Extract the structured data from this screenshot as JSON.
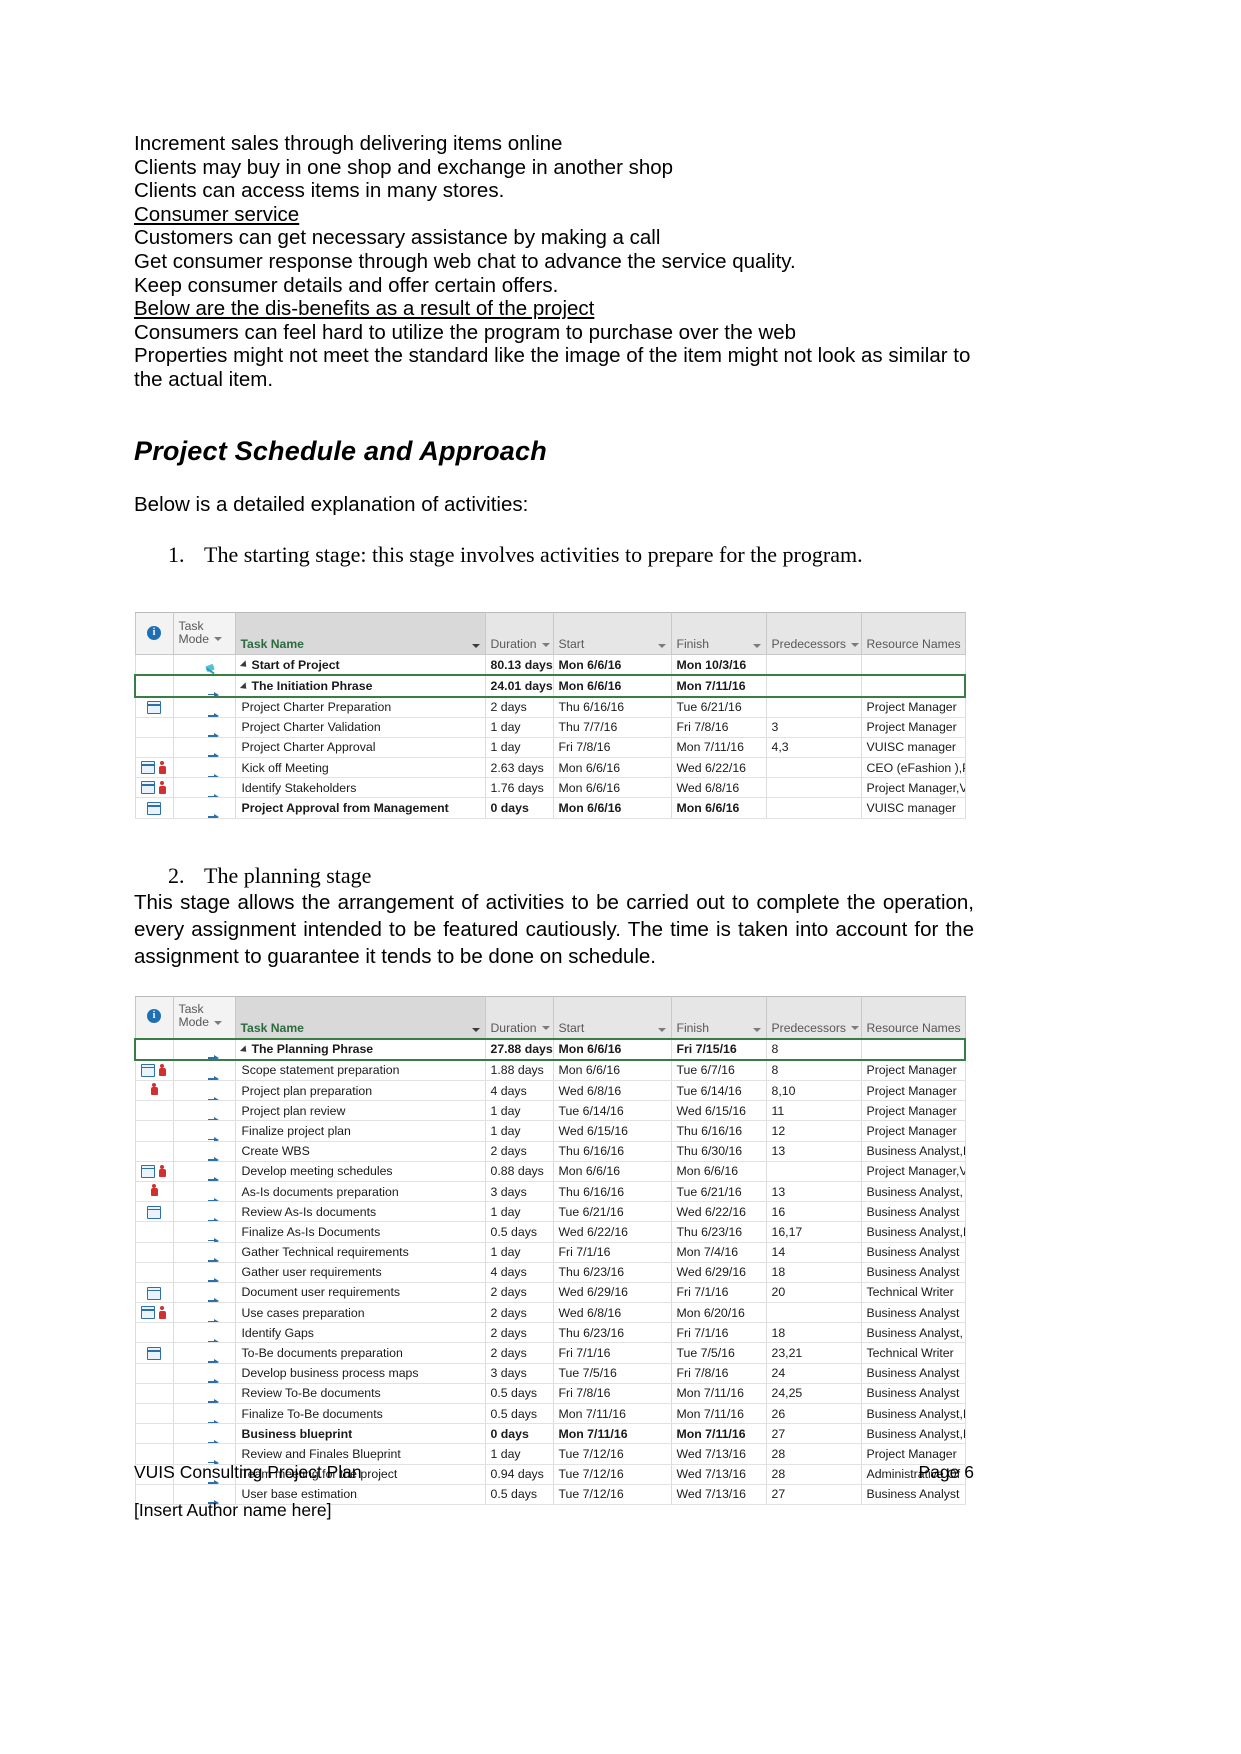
{
  "document": {
    "intro_lines": [
      {
        "text": "Increment sales through delivering items online",
        "underline": false
      },
      {
        "text": "Clients may buy in one shop and exchange in another shop",
        "underline": false
      },
      {
        "text": "Clients can access items in many stores.",
        "underline": false
      },
      {
        "text": "Consumer service",
        "underline": true
      },
      {
        "text": "Customers can get necessary assistance by making a call",
        "underline": false
      },
      {
        "text": "Get consumer response through web chat to advance the service quality.",
        "underline": false
      },
      {
        "text": "Keep consumer details and offer certain offers.",
        "underline": false
      },
      {
        "text": "Below are the dis-benefits as a result of the project",
        "underline": true
      },
      {
        "text": "Consumers can feel hard to utilize the program to purchase over the web",
        "underline": false
      }
    ],
    "wrap_paragraph": "Properties might not meet the standard like the image of the item might not look as similar to the actual item.",
    "heading": "Project Schedule and Approach",
    "lead_in": "Below is a detailed explanation of activities:",
    "list_1_number": "1.",
    "list_1_text": "The starting stage: this stage involves activities to prepare for the program.",
    "list_2_number": "2.",
    "list_2_text": "The planning stage",
    "planning_paragraph": "This stage allows the arrangement of activities to be carried out to complete the operation, every assignment intended to be featured cautiously. The time is taken into account for the assignment to guarantee it tends to be done on schedule."
  },
  "footer": {
    "left": "VUIS Consulting Project Plan",
    "right": "Page 6",
    "author": "[Insert Author name here]"
  },
  "table_columns": {
    "info": "",
    "task_mode_line1": "Task",
    "task_mode_line2": "Mode",
    "task_name": "Task Name",
    "duration": "Duration",
    "start": "Start",
    "finish": "Finish",
    "predecessors": "Predecessors",
    "resource_names": "Resource Names"
  },
  "table_initiation": {
    "rows": [
      {
        "info": "",
        "mode": "pin",
        "name": "Start of Project",
        "level": 0,
        "bold": true,
        "expander": true,
        "duration": "80.13 days",
        "start": "Mon 6/6/16",
        "finish": "Mon 10/3/16",
        "pred": "",
        "res": "",
        "selected": false
      },
      {
        "info": "",
        "mode": "auto",
        "name": "The Initiation Phrase",
        "level": 1,
        "bold": true,
        "expander": true,
        "duration": "24.01 days",
        "start": "Mon 6/6/16",
        "finish": "Mon 7/11/16",
        "pred": "",
        "res": "",
        "selected": true
      },
      {
        "info": "cal",
        "mode": "auto",
        "name": "Project Charter Preparation",
        "level": 2,
        "bold": false,
        "expander": false,
        "duration": "2 days",
        "start": "Thu 6/16/16",
        "finish": "Tue 6/21/16",
        "pred": "",
        "res": "Project Manager",
        "selected": false
      },
      {
        "info": "",
        "mode": "auto",
        "name": "Project Charter Validation",
        "level": 2,
        "bold": false,
        "expander": false,
        "duration": "1 day",
        "start": "Thu 7/7/16",
        "finish": "Fri 7/8/16",
        "pred": "3",
        "res": "Project Manager",
        "selected": false
      },
      {
        "info": "",
        "mode": "auto",
        "name": "Project Charter Approval",
        "level": 2,
        "bold": false,
        "expander": false,
        "duration": "1 day",
        "start": "Fri 7/8/16",
        "finish": "Mon 7/11/16",
        "pred": "4,3",
        "res": "VUISC manager",
        "selected": false
      },
      {
        "info": "cal-person",
        "mode": "auto",
        "name": "Kick off Meeting",
        "level": 2,
        "bold": false,
        "expander": false,
        "duration": "2.63 days",
        "start": "Mon 6/6/16",
        "finish": "Wed 6/22/16",
        "pred": "",
        "res": "CEO (eFashion ),P",
        "selected": false
      },
      {
        "info": "cal-person",
        "mode": "auto",
        "name": "Identify Stakeholders",
        "level": 2,
        "bold": false,
        "expander": false,
        "duration": "1.76 days",
        "start": "Mon 6/6/16",
        "finish": "Wed 6/8/16",
        "pred": "",
        "res": "Project Manager,V",
        "selected": false
      },
      {
        "info": "cal",
        "mode": "auto",
        "name": "Project Approval from Management",
        "level": 2,
        "bold": true,
        "expander": false,
        "duration": "0 days",
        "start": "Mon 6/6/16",
        "finish": "Mon 6/6/16",
        "pred": "",
        "res": "VUISC manager",
        "selected": false
      }
    ]
  },
  "table_planning": {
    "rows": [
      {
        "info": "",
        "mode": "auto",
        "name": "The Planning Phrase",
        "level": 1,
        "bold": true,
        "expander": true,
        "duration": "27.88 days",
        "start": "Mon 6/6/16",
        "finish": "Fri 7/15/16",
        "pred": "8",
        "res": "",
        "selected": true
      },
      {
        "info": "cal-person",
        "mode": "auto",
        "name": "Scope statement preparation",
        "level": 2,
        "bold": false,
        "expander": false,
        "duration": "1.88 days",
        "start": "Mon 6/6/16",
        "finish": "Tue 6/7/16",
        "pred": "8",
        "res": "Project Manager",
        "selected": false
      },
      {
        "info": "person",
        "mode": "auto",
        "name": "Project plan preparation",
        "level": 2,
        "bold": false,
        "expander": false,
        "duration": "4 days",
        "start": "Wed 6/8/16",
        "finish": "Tue 6/14/16",
        "pred": "8,10",
        "res": "Project Manager",
        "selected": false
      },
      {
        "info": "",
        "mode": "auto",
        "name": "Project plan review",
        "level": 2,
        "bold": false,
        "expander": false,
        "duration": "1 day",
        "start": "Tue 6/14/16",
        "finish": "Wed 6/15/16",
        "pred": "11",
        "res": "Project Manager",
        "selected": false
      },
      {
        "info": "",
        "mode": "auto",
        "name": "Finalize project plan",
        "level": 2,
        "bold": false,
        "expander": false,
        "duration": "1 day",
        "start": "Wed 6/15/16",
        "finish": "Thu 6/16/16",
        "pred": "12",
        "res": "Project Manager",
        "selected": false
      },
      {
        "info": "",
        "mode": "auto",
        "name": "Create WBS",
        "level": 2,
        "bold": false,
        "expander": false,
        "duration": "2 days",
        "start": "Thu 6/16/16",
        "finish": "Thu 6/30/16",
        "pred": "13",
        "res": "Business Analyst,I",
        "selected": false
      },
      {
        "info": "cal-person",
        "mode": "auto",
        "name": "Develop meeting schedules",
        "level": 2,
        "bold": false,
        "expander": false,
        "duration": "0.88 days",
        "start": "Mon 6/6/16",
        "finish": "Mon 6/6/16",
        "pred": "",
        "res": "Project Manager,V",
        "selected": false
      },
      {
        "info": "person",
        "mode": "auto",
        "name": "As-Is documents preparation",
        "level": 2,
        "bold": false,
        "expander": false,
        "duration": "3 days",
        "start": "Thu 6/16/16",
        "finish": "Tue 6/21/16",
        "pred": "13",
        "res": "Business Analyst,",
        "selected": false
      },
      {
        "info": "cal",
        "mode": "auto",
        "name": "Review As-Is documents",
        "level": 2,
        "bold": false,
        "expander": false,
        "duration": "1 day",
        "start": "Tue 6/21/16",
        "finish": "Wed 6/22/16",
        "pred": "16",
        "res": "Business Analyst",
        "selected": false
      },
      {
        "info": "",
        "mode": "auto",
        "name": "Finalize As-Is Documents",
        "level": 2,
        "bold": false,
        "expander": false,
        "duration": "0.5 days",
        "start": "Wed 6/22/16",
        "finish": "Thu 6/23/16",
        "pred": "16,17",
        "res": "Business Analyst,I",
        "selected": false
      },
      {
        "info": "",
        "mode": "auto",
        "name": "Gather Technical requirements",
        "level": 2,
        "bold": false,
        "expander": false,
        "duration": "1 day",
        "start": "Fri 7/1/16",
        "finish": "Mon 7/4/16",
        "pred": "14",
        "res": "Business Analyst",
        "selected": false
      },
      {
        "info": "",
        "mode": "auto",
        "name": "Gather user requirements",
        "level": 2,
        "bold": false,
        "expander": false,
        "duration": "4 days",
        "start": "Thu 6/23/16",
        "finish": "Wed 6/29/16",
        "pred": "18",
        "res": "Business Analyst",
        "selected": false
      },
      {
        "info": "cal",
        "mode": "auto",
        "name": "Document user requirements",
        "level": 2,
        "bold": false,
        "expander": false,
        "duration": "2 days",
        "start": "Wed 6/29/16",
        "finish": "Fri 7/1/16",
        "pred": "20",
        "res": "Technical Writer",
        "selected": false
      },
      {
        "info": "cal-person",
        "mode": "auto",
        "name": "Use cases preparation",
        "level": 2,
        "bold": false,
        "expander": false,
        "duration": "2 days",
        "start": "Wed 6/8/16",
        "finish": "Mon 6/20/16",
        "pred": "",
        "res": "Business Analyst",
        "selected": false
      },
      {
        "info": "",
        "mode": "auto",
        "name": "Identify Gaps",
        "level": 2,
        "bold": false,
        "expander": false,
        "duration": "2 days",
        "start": "Thu 6/23/16",
        "finish": "Fri 7/1/16",
        "pred": "18",
        "res": "Business Analyst,",
        "selected": false
      },
      {
        "info": "cal",
        "mode": "auto",
        "name": "To-Be documents preparation",
        "level": 2,
        "bold": false,
        "expander": false,
        "duration": "2 days",
        "start": "Fri 7/1/16",
        "finish": "Tue 7/5/16",
        "pred": "23,21",
        "res": "Technical Writer",
        "selected": false
      },
      {
        "info": "",
        "mode": "auto",
        "name": "Develop business process maps",
        "level": 2,
        "bold": false,
        "expander": false,
        "duration": "3 days",
        "start": "Tue 7/5/16",
        "finish": "Fri 7/8/16",
        "pred": "24",
        "res": "Business Analyst",
        "selected": false
      },
      {
        "info": "",
        "mode": "auto",
        "name": "Review To-Be documents",
        "level": 2,
        "bold": false,
        "expander": false,
        "duration": "0.5 days",
        "start": "Fri 7/8/16",
        "finish": "Mon 7/11/16",
        "pred": "24,25",
        "res": "Business Analyst",
        "selected": false
      },
      {
        "info": "",
        "mode": "auto",
        "name": "Finalize To-Be documents",
        "level": 2,
        "bold": false,
        "expander": false,
        "duration": "0.5 days",
        "start": "Mon 7/11/16",
        "finish": "Mon 7/11/16",
        "pred": "26",
        "res": "Business Analyst,I",
        "selected": false
      },
      {
        "info": "",
        "mode": "auto",
        "name": "Business blueprint",
        "level": 2,
        "bold": true,
        "expander": false,
        "duration": "0 days",
        "start": "Mon 7/11/16",
        "finish": "Mon 7/11/16",
        "pred": "27",
        "res": "Business Analyst,I",
        "selected": false
      },
      {
        "info": "",
        "mode": "auto",
        "name": "Review and Finales Blueprint",
        "level": 2,
        "bold": false,
        "expander": false,
        "duration": "1 day",
        "start": "Tue 7/12/16",
        "finish": "Wed 7/13/16",
        "pred": "28",
        "res": "Project Manager",
        "selected": false
      },
      {
        "info": "",
        "mode": "auto",
        "name": "Team meeting for the project",
        "level": 2,
        "bold": false,
        "expander": false,
        "duration": "0.94 days",
        "start": "Tue 7/12/16",
        "finish": "Wed 7/13/16",
        "pred": "28",
        "res": "Administrative Of",
        "selected": false
      },
      {
        "info": "",
        "mode": "auto",
        "name": "User base estimation",
        "level": 2,
        "bold": false,
        "expander": false,
        "duration": "0.5 days",
        "start": "Tue 7/12/16",
        "finish": "Wed 7/13/16",
        "pred": "27",
        "res": "Business Analyst",
        "selected": false
      }
    ]
  },
  "colors": {
    "header_green": "#2b6b3f",
    "selection_green": "#3a7d44",
    "header_gray": "#d9d9d9",
    "icon_blue": "#2e6fa8",
    "icon_red": "#d03030"
  }
}
